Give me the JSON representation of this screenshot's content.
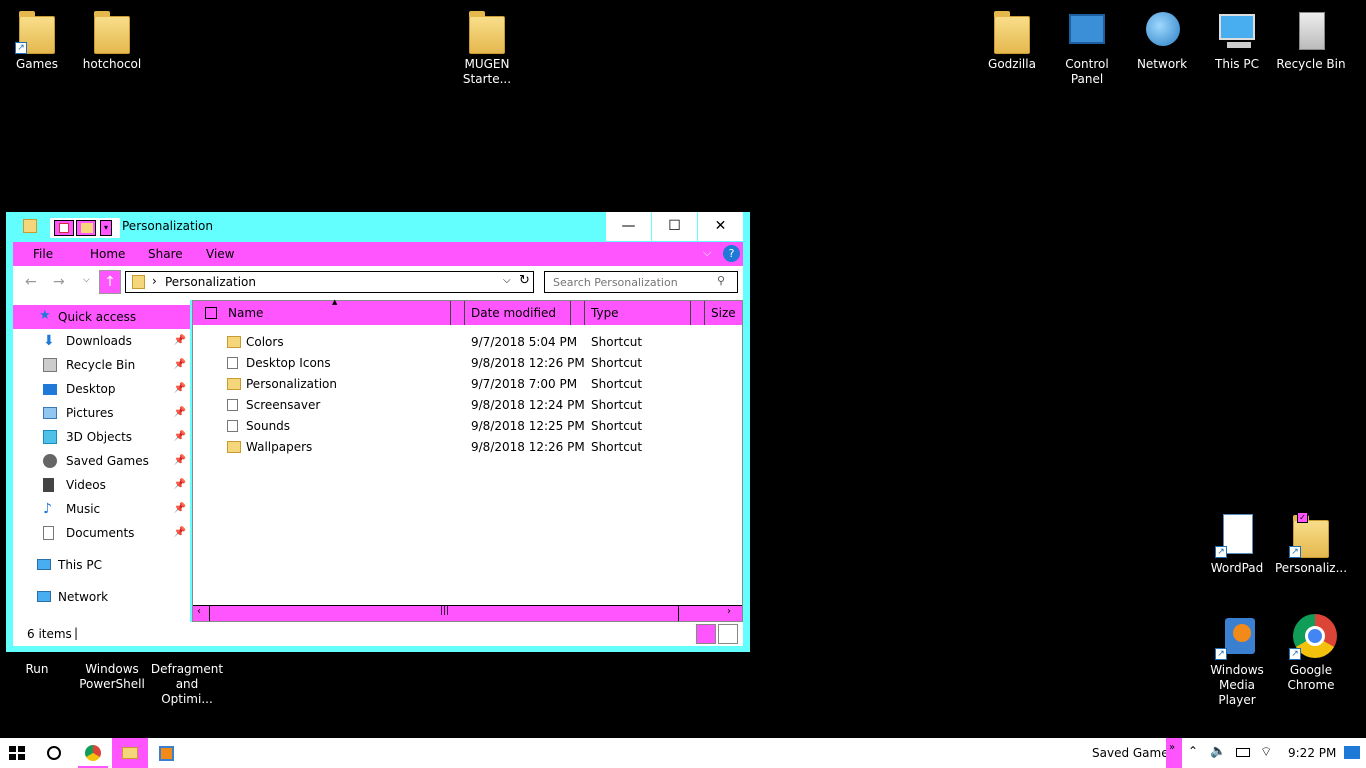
{
  "desktop": {
    "icons_top": [
      {
        "label": "Games"
      },
      {
        "label": "hotchocol"
      },
      {
        "label": "MUGEN\nStarte..."
      },
      {
        "label": "Godzilla"
      },
      {
        "label": "Control\nPanel"
      },
      {
        "label": "Network"
      },
      {
        "label": "This PC"
      },
      {
        "label": "Recycle Bin"
      }
    ],
    "icons_right": [
      {
        "label": "WordPad"
      },
      {
        "label": "Personaliz..."
      },
      {
        "label": "Windows\nMedia Player"
      },
      {
        "label": "Google\nChrome"
      }
    ],
    "icons_left_bottom": [
      {
        "label": "Run"
      },
      {
        "label": "Windows\nPowerShell"
      },
      {
        "label": "Defragment\nand Optimi..."
      }
    ]
  },
  "window": {
    "title": "Personalization",
    "buttons": {
      "minimize": "—",
      "maximize": "☐",
      "close": "✕"
    },
    "ribbon_tabs": [
      "File",
      "Home",
      "Share",
      "View"
    ],
    "address": {
      "path": "Personalization",
      "separator": "›"
    },
    "search": {
      "placeholder": "Search Personalization"
    },
    "nav": {
      "quick_access": "Quick access",
      "items": [
        {
          "label": "Downloads",
          "icon": "download-icon"
        },
        {
          "label": "Recycle Bin",
          "icon": "recycle-bin-icon"
        },
        {
          "label": "Desktop",
          "icon": "desktop-icon"
        },
        {
          "label": "Pictures",
          "icon": "pictures-icon"
        },
        {
          "label": "3D Objects",
          "icon": "3d-objects-icon"
        },
        {
          "label": "Saved Games",
          "icon": "saved-games-icon"
        },
        {
          "label": "Videos",
          "icon": "videos-icon"
        },
        {
          "label": "Music",
          "icon": "music-icon"
        },
        {
          "label": "Documents",
          "icon": "documents-icon"
        }
      ],
      "this_pc": "This PC",
      "network": "Network"
    },
    "columns": {
      "name": "Name",
      "date": "Date modified",
      "type": "Type",
      "size": "Size"
    },
    "files": [
      {
        "name": "Colors",
        "date": "9/7/2018 5:04 PM",
        "type": "Shortcut",
        "icon": "folder-shortcut-icon"
      },
      {
        "name": "Desktop Icons",
        "date": "9/8/2018 12:26 PM",
        "type": "Shortcut",
        "icon": "file-shortcut-icon"
      },
      {
        "name": "Personalization",
        "date": "9/7/2018 7:00 PM",
        "type": "Shortcut",
        "icon": "folder-shortcut-icon"
      },
      {
        "name": "Screensaver",
        "date": "9/8/2018 12:24 PM",
        "type": "Shortcut",
        "icon": "file-shortcut-icon"
      },
      {
        "name": "Sounds",
        "date": "9/8/2018 12:25 PM",
        "type": "Shortcut",
        "icon": "file-shortcut-icon"
      },
      {
        "name": "Wallpapers",
        "date": "9/8/2018 12:26 PM",
        "type": "Shortcut",
        "icon": "folder-shortcut-icon"
      }
    ],
    "status": "6 items"
  },
  "taskbar": {
    "notification_label": "Saved Games",
    "time": "9:22 PM"
  },
  "colors": {
    "window_frame": "#63ffff",
    "ribbon": "#ff55ff",
    "desktop": "#000000"
  }
}
